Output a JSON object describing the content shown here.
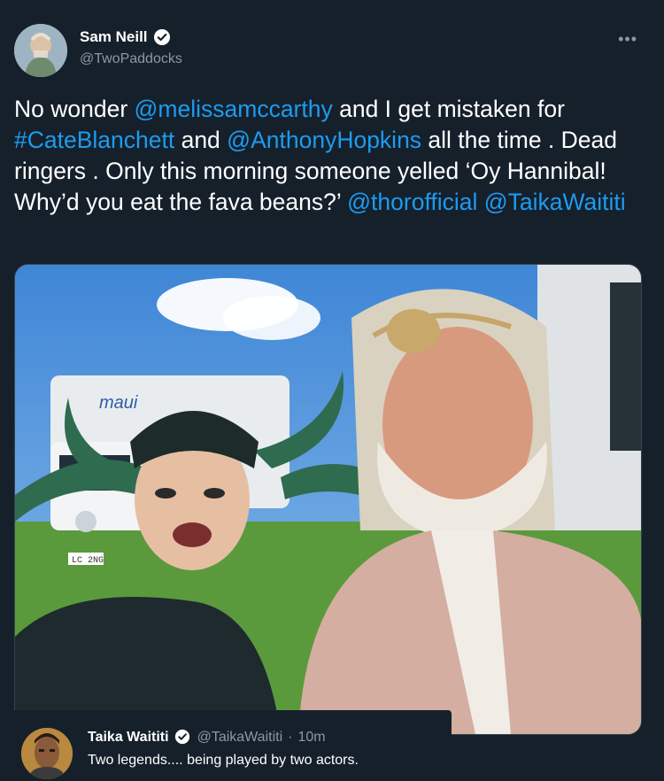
{
  "author": {
    "display_name": "Sam Neill",
    "handle": "@TwoPaddocks",
    "verified_icon": "verified-badge-icon"
  },
  "more_icon": "more-options-icon",
  "tweet": {
    "segments": [
      {
        "t": "No wonder ",
        "link": false
      },
      {
        "t": "@melissamccarthy",
        "link": true
      },
      {
        "t": " and I get mistaken for ",
        "link": false
      },
      {
        "t": "#CateBlanchett",
        "link": true
      },
      {
        "t": " and ",
        "link": false
      },
      {
        "t": "@AnthonyHopkins",
        "link": true
      },
      {
        "t": " all the time . Dead ringers . Only this morning someone yelled ‘Oy Hannibal! Why’d you eat the fava beans?’ ",
        "link": false
      },
      {
        "t": "@thorofficial",
        "link": true
      },
      {
        "t": " ",
        "link": false
      },
      {
        "t": "@TaikaWaititi",
        "link": true
      }
    ]
  },
  "media": {
    "van_logo": "maui",
    "plate_text": "LC 2NG"
  },
  "quote": {
    "display_name": "Taika Waititi",
    "handle": "@TaikaWaititi",
    "separator": "·",
    "time": "10m",
    "text": "Two legends.... being played by two actors."
  },
  "colors": {
    "background": "#15202b",
    "link": "#1d9bf0",
    "muted": "#8b98a5"
  }
}
